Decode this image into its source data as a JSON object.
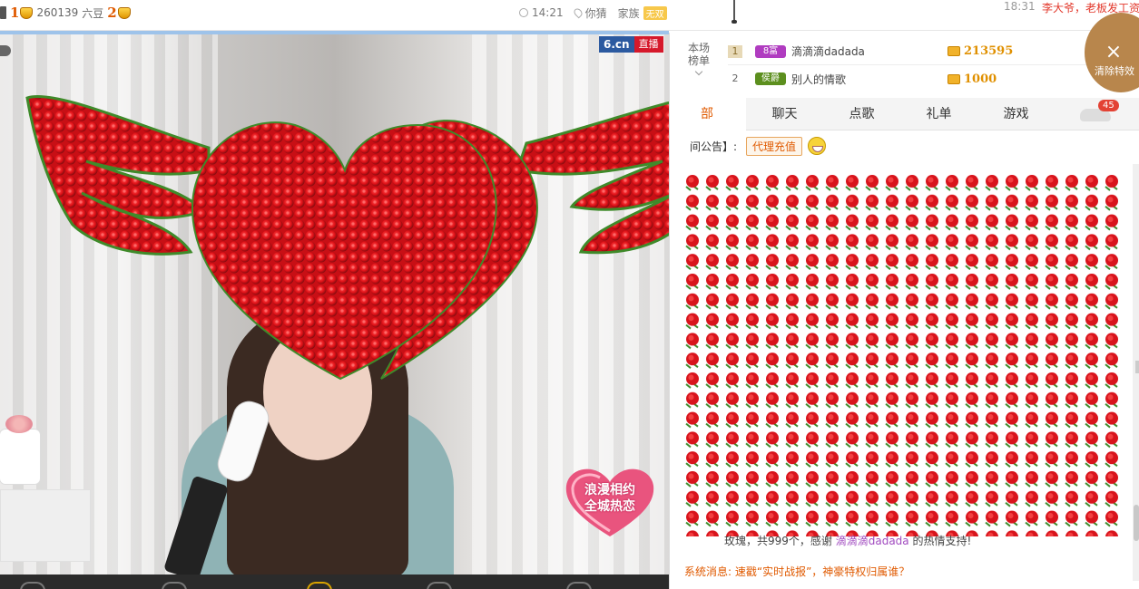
{
  "topbar": {
    "rank1": "1",
    "room_id": "260139",
    "currency_label": "六豆",
    "rank2": "2",
    "time": "14:21",
    "location": "你猜",
    "family_label": "家族",
    "family_badge": "无双",
    "chat_time": "18:31",
    "chat_text": "李大爷，老板发工资"
  },
  "video": {
    "site_logo": "6.cn",
    "live_label": "直播",
    "promo_line1": "浪漫相约",
    "promo_line2": "全城热恋"
  },
  "ranking": {
    "header_line1": "本场",
    "header_line2": "榜单",
    "rows": [
      {
        "rank": "1",
        "level": "8富",
        "name": "滴滴滴dadada",
        "amount": "213595",
        "level_color": "#b03cc0"
      },
      {
        "rank": "2",
        "level": "侯爵",
        "name": "别人的情歌",
        "amount": "1000",
        "level_color": "#5c8f1e"
      }
    ]
  },
  "clear_button": {
    "icon": "×",
    "label": "清除特效"
  },
  "tabs": {
    "items": [
      "部",
      "聊天",
      "点歌",
      "礼单",
      "游戏"
    ],
    "badge": "45"
  },
  "notice": {
    "label": "间公告】:",
    "button": "代理充值"
  },
  "chat": {
    "gift_pre": "玫瑰，共999个，感谢",
    "gift_user": "滴滴滴dadada",
    "gift_post": "的热情支持!",
    "system": "系统消息: 速戳“实时战报”，神豪特权归属谁？"
  },
  "colors": {
    "accent": "#e05a00",
    "rose": "#d8141c",
    "brand_blue": "#2c5aa0"
  }
}
